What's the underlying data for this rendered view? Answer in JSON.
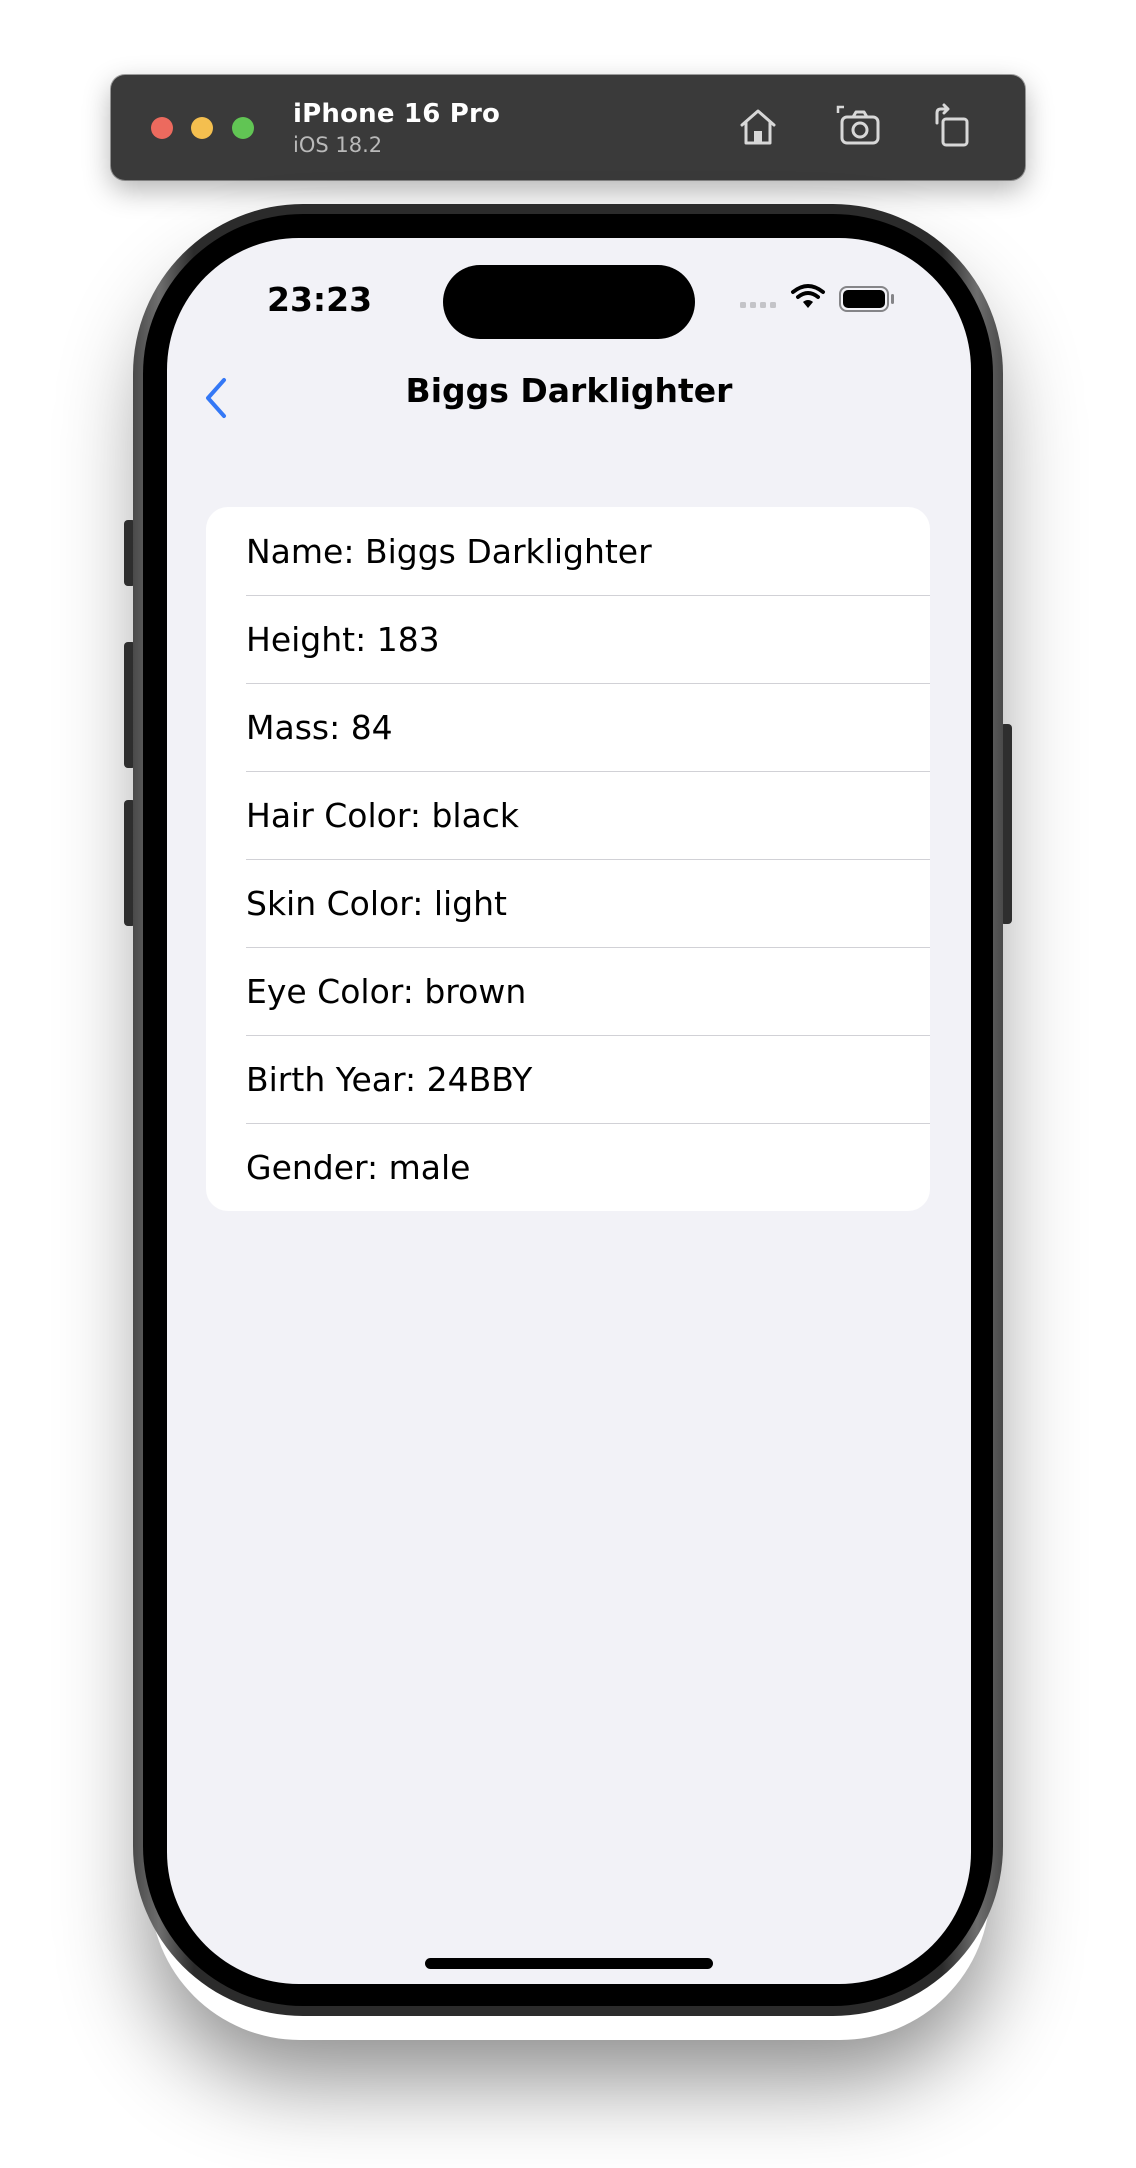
{
  "simulator": {
    "device_name": "iPhone 16 Pro",
    "os_version": "iOS 18.2",
    "icons": [
      "home-icon",
      "screenshot-icon",
      "rotate-icon"
    ]
  },
  "status_bar": {
    "time": "23:23",
    "icons": [
      "cellular-signal-icon",
      "wifi-icon",
      "battery-icon"
    ]
  },
  "nav": {
    "title": "Biggs Darklighter",
    "back_icon": "chevron-left-icon",
    "accent_color": "#3478f6"
  },
  "details": {
    "rows": [
      {
        "text": "Name: Biggs Darklighter"
      },
      {
        "text": "Height: 183"
      },
      {
        "text": "Mass: 84"
      },
      {
        "text": "Hair Color: black"
      },
      {
        "text": "Skin Color: light"
      },
      {
        "text": "Eye Color: brown"
      },
      {
        "text": "Birth Year: 24BBY"
      },
      {
        "text": "Gender: male"
      }
    ]
  },
  "colors": {
    "background": "#f2f2f7",
    "card": "#ffffff",
    "separator": "#d1d1d6"
  }
}
